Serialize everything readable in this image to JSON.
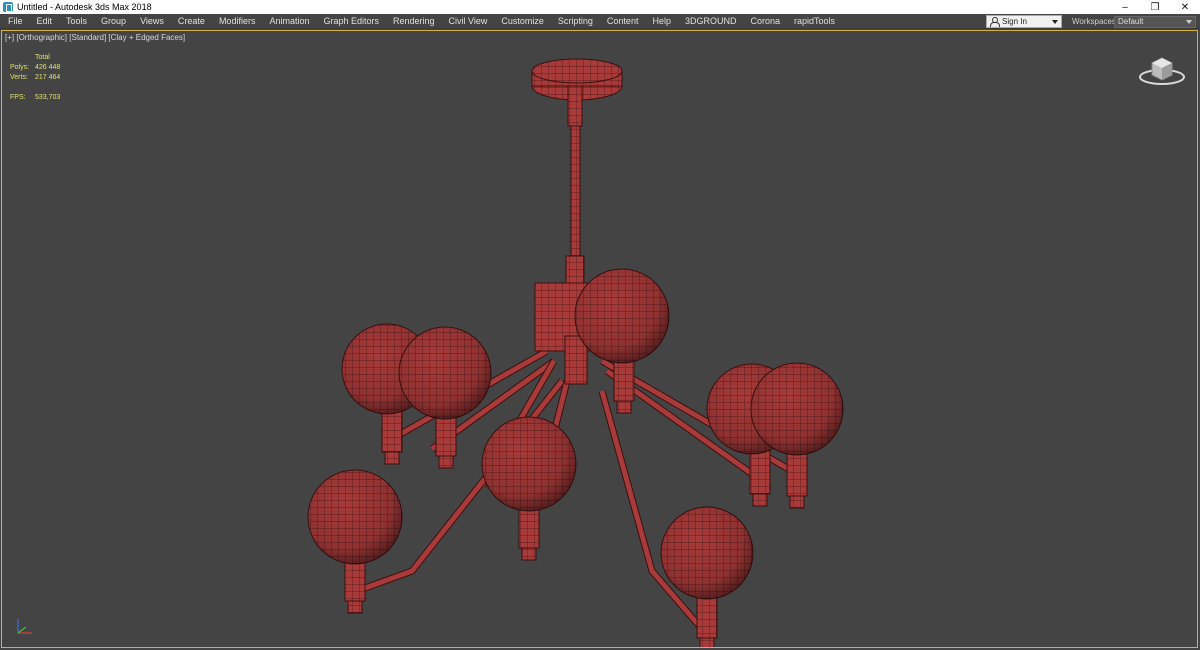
{
  "window": {
    "title": "Untitled - Autodesk 3ds Max 2018",
    "minimize": "–",
    "restore": "❐",
    "close": "✕"
  },
  "menu": [
    "File",
    "Edit",
    "Tools",
    "Group",
    "Views",
    "Create",
    "Modifiers",
    "Animation",
    "Graph Editors",
    "Rendering",
    "Civil View",
    "Customize",
    "Scripting",
    "Content",
    "Help",
    "3DGROUND",
    "Corona",
    "rapidTools"
  ],
  "account": {
    "signin_label": "Sign In",
    "workspaces_label": "Workspaces:",
    "workspace_value": "Default"
  },
  "viewport": {
    "label": "[+] [Orthographic] [Standard] [Clay + Edged Faces]",
    "stats": {
      "header": "Total",
      "polys_label": "Polys:",
      "polys_value": "426 448",
      "verts_label": "Verts:",
      "verts_value": "217 464",
      "fps_label": "FPS:",
      "fps_value": "533,703"
    }
  },
  "colors": {
    "viewport_bg": "#444444",
    "viewport_border": "#d3b33a",
    "clay": "#a83a3a",
    "wire": "#4a1414",
    "stats_text": "#e3e36a"
  },
  "icons": [
    "app-icon",
    "user-icon",
    "viewcube-icon",
    "axis-tripod-icon"
  ]
}
